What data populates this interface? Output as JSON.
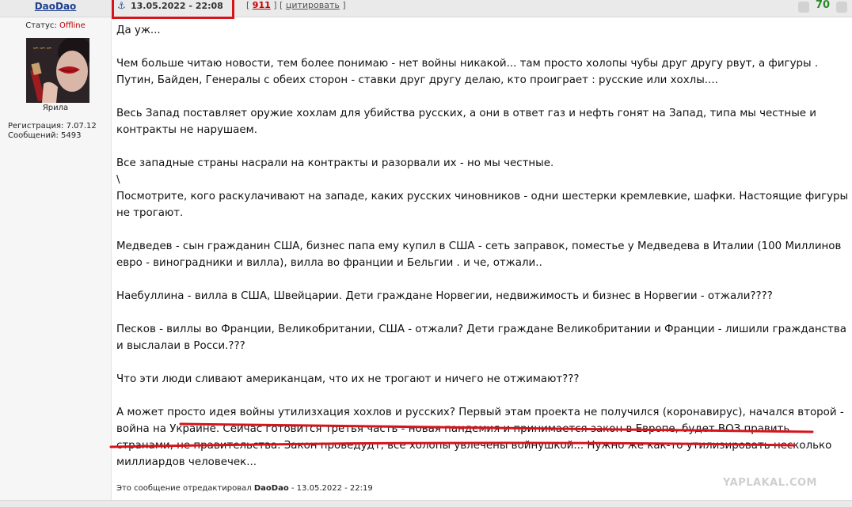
{
  "user": {
    "name": "DaoDao",
    "status_label": "Статус:",
    "status_value": "Offline",
    "avatar_caption": "Ярила",
    "registration": "Регистрация: 7.07.12",
    "messages": "Сообщений: 5493"
  },
  "post": {
    "datetime": "13.05.2022 - 22:08",
    "number": "911",
    "quote_label": "цитировать",
    "rating": "70",
    "paragraphs": [
      "Да уж...",
      "Чем больше читаю новости, тем более понимаю - нет войны никакой... там просто холопы чубы друг другу рвут, а фигуры . Путин, Байден, Генералы с обеих сторон - ставки друг другу делаю, кто проиграет : русские или хохлы....",
      "Весь Запад поставляет оружие хохлам для убийства русских, а они в ответ газ и нефть гонят на Запад, типа мы честные и контракты не нарушаем.",
      "Все западные страны насрали на контракты и разорвали их - но мы честные.",
      "\\",
      "Посмотрите, кого раскулачивают на западе, каких русских чиновников - одни шестерки кремлевкие, шафки. Настоящие фигуры не трогают.",
      "Медведев - сын гражданин США, бизнес папа ему купил в США - сеть заправок, поместье у Медведева в Италии (100 Миллинов евро - виноградники и вилла), вилла во франции и Бельгии . и че, отжали..",
      "Наебуллина - вилла в США, Швейцарии. Дети граждане Норвегии, недвижимость и бизнес в Норвегии - отжали????",
      "Песков - виллы во Франции, Великобритании, США - отжали? Дети граждане Великобритании и Франции - лишили гражданства и выслалаи в Росси.???",
      "Что эти люди сливают американцам, что их не трогают и ничего не отжимают???",
      "А может просто идея войны утилизхация хохлов и русских? Первый этам проекта не получился (коронавирус), начался второй - война на Украине. Сейчас готовится третья часть - новая пандемия и принимается закон в Европе, будет ВОЗ править странами, не правительства. Закон проведудт, все холопы увлечены войнушкой... Нужно же как-то утилизировать несколько миллиардов человечек..."
    ],
    "edit_prefix": "Это сообщение отредактировал",
    "edit_user": "DaoDao",
    "edit_suffix": " - 13.05.2022 - 22:19"
  },
  "watermark": "YAPLAKAL.COM",
  "colors": {
    "status_offline": "#c00000",
    "highlight_box": "#d7141c",
    "rating": "#2c8a2c"
  }
}
